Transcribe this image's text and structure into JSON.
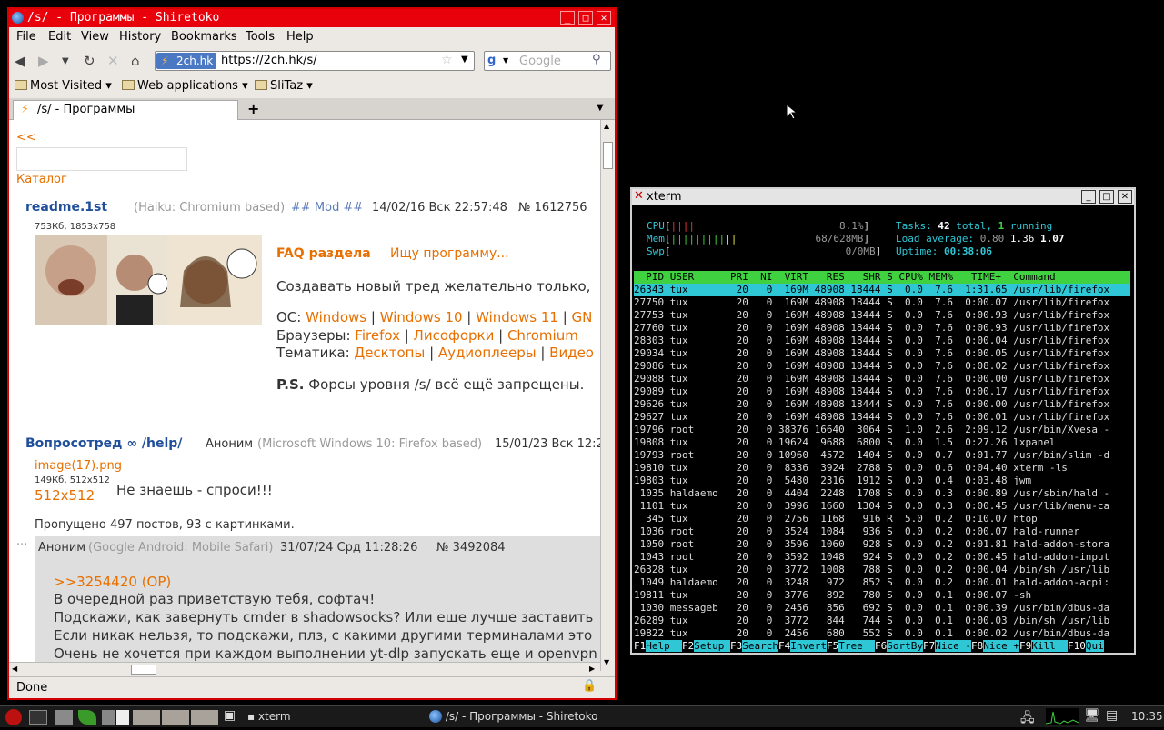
{
  "firefox": {
    "title": "/s/ - Программы - Shiretoko",
    "menu": [
      "File",
      "Edit",
      "View",
      "History",
      "Bookmarks",
      "Tools",
      "Help"
    ],
    "site_badge": "2ch.hk",
    "url": "https://2ch.hk/s/",
    "search_placeholder": "Google",
    "bookmarks": [
      "Most Visited",
      "Web applications",
      "SliTaz"
    ],
    "tab_title": "/s/ - Программы",
    "status": "Done"
  },
  "page": {
    "back_link": "<<",
    "catalog": "Каталог",
    "thread1": {
      "subject": "readme.1st",
      "meta": "(Haiku: Chromium based)",
      "mod": "## Mod ##",
      "date": "14/02/16 Вск 22:57:48",
      "num": "№ 1612756",
      "img_info": "753Кб, 1853x758",
      "faq": "FAQ раздела",
      "search_prog": "Ищу программу...",
      "line1": "Создавать новый тред желательно только,",
      "os_label": "ОС:",
      "os": [
        "Windows",
        "Windows 10",
        "Windows 11",
        "GN"
      ],
      "browsers_label": "Браузеры:",
      "browsers": [
        "Firefox",
        "Лисофорки",
        "Chromium"
      ],
      "topics_label": "Тематика:",
      "topics": [
        "Десктопы",
        "Аудиоплееры",
        "Видео"
      ],
      "ps_label": "P.S.",
      "ps": "Форсы уровня /s/ всё ещё запрещены."
    },
    "thread2": {
      "subject": "Вопросотред ∞ /help/",
      "author": "Аноним",
      "meta": "(Microsoft Windows 10: Firefox based)",
      "date": "15/01/23 Вск 12:2",
      "img_name": "image(17).png",
      "img_info": "149Кб, 512x512",
      "img_dims": "512x512",
      "text": "Не знаешь - спроси!!!",
      "skipped": "Пропущено 497 постов, 93 с картинками."
    },
    "reply": {
      "dots": "...",
      "author": "Аноним",
      "meta": "(Google Android: Mobile Safari)",
      "date": "31/07/24 Срд 11:28:26",
      "num": "№ 3492084",
      "ref": ">>3254420 (OP)",
      "lines": [
        "В очередной раз приветствую тебя, софтач!",
        "Подскажи, как завернуть cmder в shadowsocks? Или еще лучше заставить",
        "Если никак нельзя, то подскажи, плз, с какими другими терминалами это",
        "Очень не хочется при каждом выполнении yt-dlp запускать еще и openvpn"
      ]
    }
  },
  "xterm": {
    "title": "xterm",
    "cpu_pct": "8.1%",
    "mem": "68/628MB",
    "swp": "0/0MB",
    "tasks": "42",
    "running": "1",
    "load": [
      "0.80",
      "1.36",
      "1.07"
    ],
    "uptime": "00:38:06",
    "header": "  PID USER      PRI  NI  VIRT   RES   SHR S CPU% MEM%   TIME+  Command",
    "rows": [
      "26343 tux        20   0  169M 48908 18444 S  0.0  7.6  1:31.65 /usr/lib/firefox",
      "27750 tux        20   0  169M 48908 18444 S  0.0  7.6  0:00.07 /usr/lib/firefox",
      "27753 tux        20   0  169M 48908 18444 S  0.0  7.6  0:00.93 /usr/lib/firefox",
      "27760 tux        20   0  169M 48908 18444 S  0.0  7.6  0:00.93 /usr/lib/firefox",
      "28303 tux        20   0  169M 48908 18444 S  0.0  7.6  0:00.04 /usr/lib/firefox",
      "29034 tux        20   0  169M 48908 18444 S  0.0  7.6  0:00.05 /usr/lib/firefox",
      "29086 tux        20   0  169M 48908 18444 S  0.0  7.6  0:08.02 /usr/lib/firefox",
      "29088 tux        20   0  169M 48908 18444 S  0.0  7.6  0:00.00 /usr/lib/firefox",
      "29089 tux        20   0  169M 48908 18444 S  0.0  7.6  0:00.17 /usr/lib/firefox",
      "29626 tux        20   0  169M 48908 18444 S  0.0  7.6  0:00.00 /usr/lib/firefox",
      "29627 tux        20   0  169M 48908 18444 S  0.0  7.6  0:00.01 /usr/lib/firefox",
      "19796 root       20   0 38376 16640  3064 S  1.0  2.6  2:09.12 /usr/bin/Xvesa -",
      "19808 tux        20   0 19624  9688  6800 S  0.0  1.5  0:27.26 lxpanel",
      "19793 root       20   0 10960  4572  1404 S  0.0  0.7  0:01.77 /usr/bin/slim -d",
      "19810 tux        20   0  8336  3924  2788 S  0.0  0.6  0:04.40 xterm -ls",
      "19803 tux        20   0  5480  2316  1912 S  0.0  0.4  0:03.48 jwm",
      " 1035 haldaemo   20   0  4404  2248  1708 S  0.0  0.3  0:00.89 /usr/sbin/hald -",
      " 1101 tux        20   0  3996  1660  1304 S  0.0  0.3  0:00.45 /usr/lib/menu-ca",
      "  345 tux        20   0  2756  1168   916 R  5.0  0.2  0:10.07 htop",
      " 1036 root       20   0  3524  1084   936 S  0.0  0.2  0:00.07 hald-runner",
      " 1050 root       20   0  3596  1060   928 S  0.0  0.2  0:01.81 hald-addon-stora",
      " 1043 root       20   0  3592  1048   924 S  0.0  0.2  0:00.45 hald-addon-input",
      "26328 tux        20   0  3772  1008   788 S  0.0  0.2  0:00.04 /bin/sh /usr/lib",
      " 1049 haldaemo   20   0  3248   972   852 S  0.0  0.2  0:00.01 hald-addon-acpi:",
      "19811 tux        20   0  3776   892   780 S  0.0  0.1  0:00.07 -sh",
      " 1030 messageb   20   0  2456   856   692 S  0.0  0.1  0:00.39 /usr/bin/dbus-da",
      "26289 tux        20   0  3772   844   744 S  0.0  0.1  0:00.03 /bin/sh /usr/lib",
      "19822 tux        20   0  2456   680   552 S  0.0  0.1  0:00.02 /usr/bin/dbus-da"
    ],
    "fkeys": [
      {
        "k": "F1",
        "l": "Help  "
      },
      {
        "k": "F2",
        "l": "Setup "
      },
      {
        "k": "F3",
        "l": "Search"
      },
      {
        "k": "F4",
        "l": "Invert"
      },
      {
        "k": "F5",
        "l": "Tree  "
      },
      {
        "k": "F6",
        "l": "SortBy"
      },
      {
        "k": "F7",
        "l": "Nice -"
      },
      {
        "k": "F8",
        "l": "Nice +"
      },
      {
        "k": "F9",
        "l": "Kill  "
      },
      {
        "k": "F10",
        "l": "Qui"
      }
    ]
  },
  "taskbar": {
    "xterm_task": "xterm",
    "ff_task": "/s/ - Программы - Shiretoko",
    "clock": "10:35"
  },
  "colors": {
    "ff_border": "#d40000",
    "link": "#e76f00",
    "subject": "#1f4f9a",
    "htop_bar": "#3fd13f",
    "htop_sel": "#2fc7d6"
  }
}
